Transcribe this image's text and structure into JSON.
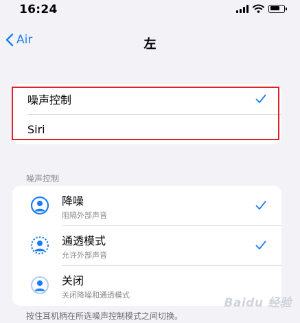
{
  "status": {
    "time": "16:24"
  },
  "nav": {
    "back_label": "Air",
    "title": "左"
  },
  "top_options": [
    {
      "label": "噪声控制",
      "checked": true
    },
    {
      "label": "Siri",
      "checked": false
    }
  ],
  "section": {
    "header": "噪声控制",
    "items": [
      {
        "title": "降噪",
        "subtitle": "阻隔外部声音",
        "icon": "noise-cancel-icon",
        "checked": true
      },
      {
        "title": "通透模式",
        "subtitle": "允许外部声音",
        "icon": "transparency-icon",
        "checked": true
      },
      {
        "title": "关闭",
        "subtitle": "关闭降噪和通透模式",
        "icon": "off-mode-icon",
        "checked": false
      }
    ]
  },
  "footer": "按住耳机柄在所选噪声控制模式之间切换。",
  "watermark": "Baidu 经验",
  "colors": {
    "accent": "#1a7cf5",
    "highlight": "#e0202a",
    "background": "#f2f2f7"
  }
}
